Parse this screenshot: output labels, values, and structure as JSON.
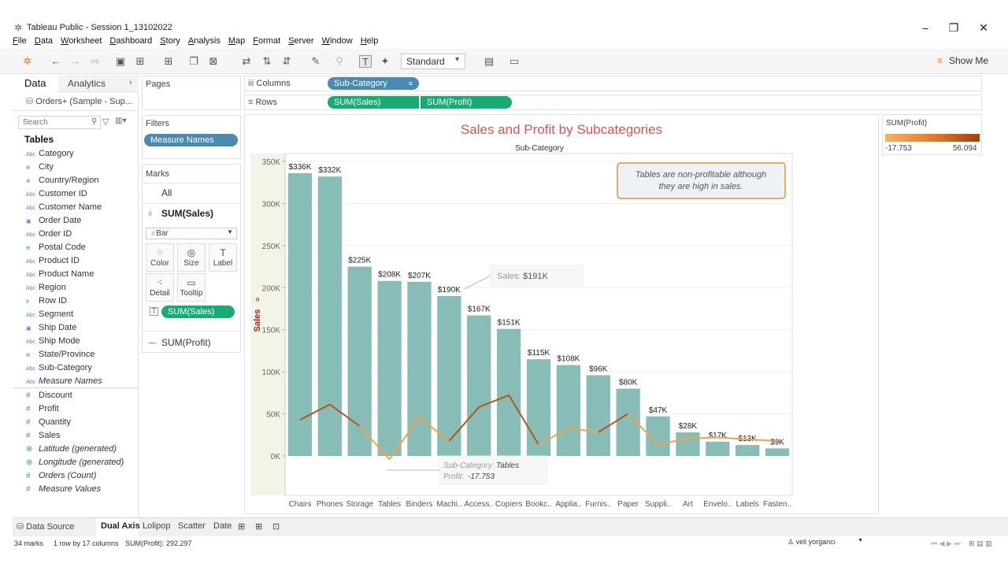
{
  "window": {
    "title": "Tableau Public - Session 1_13102022",
    "minimize": "–",
    "maximize": "❐",
    "close": "✕"
  },
  "menu": [
    "File",
    "Data",
    "Worksheet",
    "Dashboard",
    "Story",
    "Analysis",
    "Map",
    "Format",
    "Server",
    "Window",
    "Help"
  ],
  "toolbar": {
    "fit_select": "Standard",
    "show_me": "Show Me"
  },
  "data_pane": {
    "tab_data": "Data",
    "tab_analytics": "Analytics",
    "datasource": "Orders+ (Sample - Sup...",
    "search_placeholder": "Search",
    "tables_heading": "Tables",
    "dimensions": [
      {
        "icon": "Abc",
        "name": "Category"
      },
      {
        "icon": "⊕",
        "name": "City"
      },
      {
        "icon": "⊕",
        "name": "Country/Region"
      },
      {
        "icon": "Abc",
        "name": "Customer ID"
      },
      {
        "icon": "Abc",
        "name": "Customer Name"
      },
      {
        "icon": "▣",
        "name": "Order Date"
      },
      {
        "icon": "Abc",
        "name": "Order ID"
      },
      {
        "icon": "⊕",
        "name": "Postal Code"
      },
      {
        "icon": "Abc",
        "name": "Product ID"
      },
      {
        "icon": "Abc",
        "name": "Product Name"
      },
      {
        "icon": "Abc",
        "name": "Region"
      },
      {
        "icon": "#",
        "name": "Row ID"
      },
      {
        "icon": "Abc",
        "name": "Segment"
      },
      {
        "icon": "▣",
        "name": "Ship Date"
      },
      {
        "icon": "Abc",
        "name": "Ship Mode"
      },
      {
        "icon": "⊕",
        "name": "State/Province"
      },
      {
        "icon": "Abc",
        "name": "Sub-Category"
      },
      {
        "icon": "Abc",
        "name": "Measure Names",
        "italic": true
      }
    ],
    "measures": [
      {
        "icon": "#",
        "name": "Discount"
      },
      {
        "icon": "#",
        "name": "Profit"
      },
      {
        "icon": "#",
        "name": "Quantity"
      },
      {
        "icon": "#",
        "name": "Sales"
      },
      {
        "icon": "⊕",
        "name": "Latitude (generated)",
        "italic": true
      },
      {
        "icon": "⊕",
        "name": "Longitude (generated)",
        "italic": true
      },
      {
        "icon": "#",
        "name": "Orders (Count)",
        "italic": true
      },
      {
        "icon": "#",
        "name": "Measure Values",
        "italic": true
      }
    ]
  },
  "pages": {
    "title": "Pages"
  },
  "filters": {
    "title": "Filters",
    "pill": "Measure Names"
  },
  "marks": {
    "title": "Marks",
    "all": "All",
    "sum_sales": "SUM(Sales)",
    "mark_type": "Bar",
    "buttons": {
      "color": "Color",
      "size": "Size",
      "label": "Label",
      "detail": "Detail",
      "tooltip": "Tooltip"
    },
    "label_pill": "SUM(Sales)",
    "sum_profit": "SUM(Profit)"
  },
  "shelves": {
    "columns_label": "Columns",
    "rows_label": "Rows",
    "columns_pill": "Sub-Category",
    "rows_pills": [
      "SUM(Sales)",
      "SUM(Profit)"
    ]
  },
  "legend": {
    "title": "SUM(Profit)",
    "min": "-17.753",
    "max": "56.094"
  },
  "tooltips": {
    "sales_label": "Sales:",
    "sales_value": "$191K",
    "profit_subcat_label": "Sub-Category:",
    "profit_subcat_value": "Tables",
    "profit_label": "Profit:",
    "profit_value": "-17.753"
  },
  "annotation": "Tables are non-profitable although they are high in sales.",
  "colors": {
    "bar": "#87bdb6",
    "profit_line_neg": "#f3a24d",
    "profit_line_pos": "#b85418",
    "title": "#d9534f",
    "accent_orange": "#e8913a"
  },
  "chart_data": {
    "type": "bar",
    "title": "Sales and Profit by Subcategories",
    "xlabel": "Sub-Category",
    "ylabel": "Sales",
    "ylim": [
      0,
      350000
    ],
    "yticks": [
      "0K",
      "50K",
      "100K",
      "150K",
      "200K",
      "250K",
      "300K",
      "350K"
    ],
    "categories": [
      "Chairs",
      "Phones",
      "Storage",
      "Tables",
      "Binders",
      "Machi..",
      "Access..",
      "Copiers",
      "Bookc..",
      "Applia..",
      "Furnis..",
      "Paper",
      "Suppli..",
      "Art",
      "Envelo..",
      "Labels",
      "Fasten.."
    ],
    "series": [
      {
        "name": "SUM(Sales)",
        "type": "bar",
        "values": [
          336000,
          332000,
          225000,
          208000,
          207000,
          190000,
          167000,
          151000,
          115000,
          108000,
          96000,
          80000,
          47000,
          28000,
          17000,
          13000,
          9000
        ],
        "labels": [
          "$336K",
          "$332K",
          "$225K",
          "$208K",
          "$207K",
          "$190K",
          "$167K",
          "$151K",
          "$115K",
          "$108K",
          "$96K",
          "$80K",
          "$47K",
          "$28K",
          "$17K",
          "$13K",
          "$9K"
        ]
      },
      {
        "name": "SUM(Profit)",
        "type": "line",
        "values": [
          27.0,
          44.5,
          20.0,
          -17.753,
          30.0,
          3.0,
          41.5,
          55.0,
          -1.0,
          17.5,
          13.0,
          34.0,
          -1.0,
          6.0,
          7.0,
          5.0,
          3.0
        ]
      }
    ],
    "profit_ylim": [
      -30,
      320
    ]
  },
  "bottom_tabs": [
    "Data Source",
    "Dual Axis",
    "Lolipop",
    "Scatter",
    "Date"
  ],
  "status": {
    "marks": "34 marks",
    "rows_cols": "1 row by 17 columns",
    "sum_profit": "SUM(Profit): 292.297",
    "user": "veli yorgancı"
  }
}
